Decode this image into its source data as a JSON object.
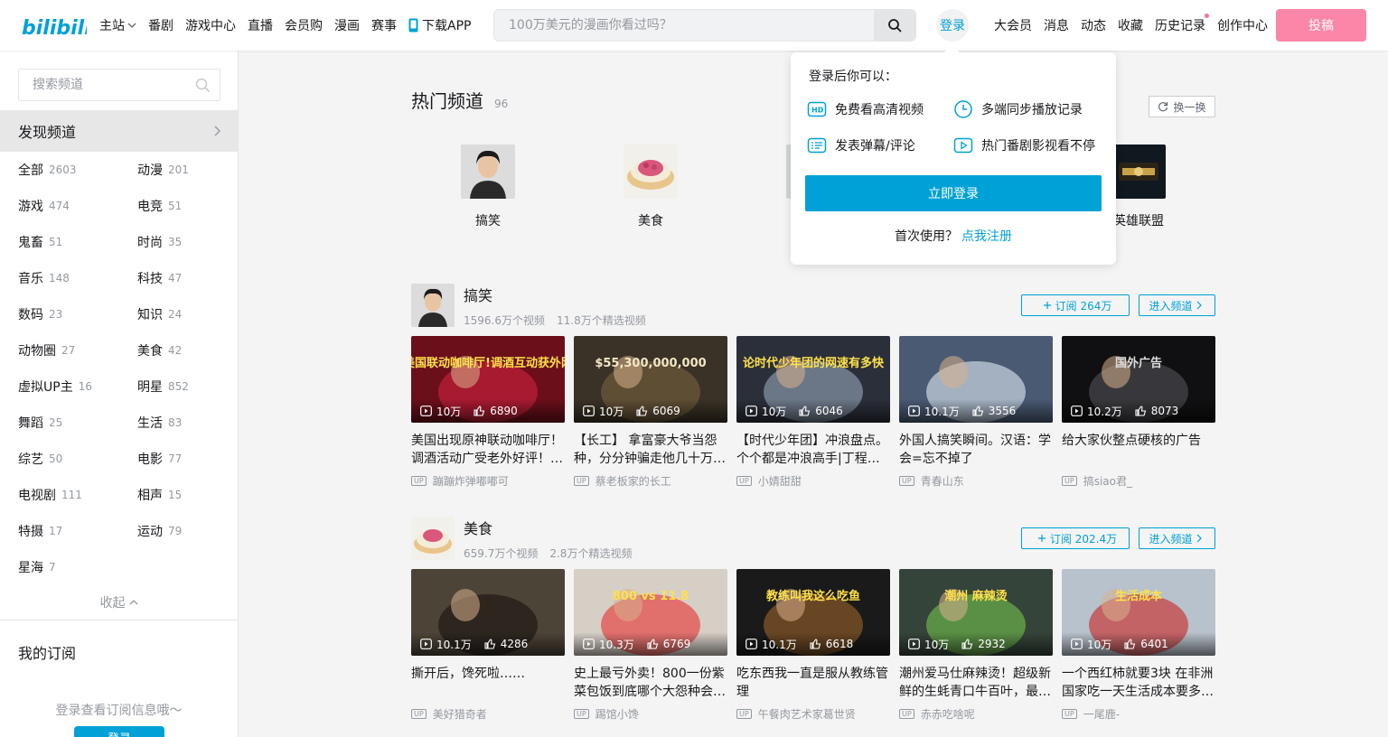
{
  "header": {
    "logo_text": "bilibili",
    "nav_left": [
      "主站",
      "番剧",
      "游戏中心",
      "直播",
      "会员购",
      "漫画",
      "赛事",
      "下载APP"
    ],
    "search_placeholder": "100万美元的漫画你看过吗？",
    "login_label": "登录",
    "nav_right": [
      "大会员",
      "消息",
      "动态",
      "收藏",
      "历史记录",
      "创作中心"
    ],
    "upload_label": "投稿"
  },
  "sidebar": {
    "search_placeholder": "搜索频道",
    "discover_label": "发现频道",
    "categories": [
      {
        "name": "全部",
        "count": "2603"
      },
      {
        "name": "动漫",
        "count": "201"
      },
      {
        "name": "游戏",
        "count": "474"
      },
      {
        "name": "电竞",
        "count": "51"
      },
      {
        "name": "鬼畜",
        "count": "51"
      },
      {
        "name": "时尚",
        "count": "35"
      },
      {
        "name": "音乐",
        "count": "148"
      },
      {
        "name": "科技",
        "count": "47"
      },
      {
        "name": "数码",
        "count": "23"
      },
      {
        "name": "知识",
        "count": "24"
      },
      {
        "name": "动物圈",
        "count": "27"
      },
      {
        "name": "美食",
        "count": "42"
      },
      {
        "name": "虚拟UP主",
        "count": "16"
      },
      {
        "name": "明星",
        "count": "852"
      },
      {
        "name": "舞蹈",
        "count": "25"
      },
      {
        "name": "生活",
        "count": "83"
      },
      {
        "name": "综艺",
        "count": "50"
      },
      {
        "name": "电影",
        "count": "77"
      },
      {
        "name": "电视剧",
        "count": "111"
      },
      {
        "name": "相声",
        "count": "15"
      },
      {
        "name": "特摄",
        "count": "17"
      },
      {
        "name": "运动",
        "count": "79"
      },
      {
        "name": "星海",
        "count": "7"
      }
    ],
    "collapse_label": "收起",
    "my_sub_title": "我的订阅",
    "my_sub_tip": "登录查看订阅信息哦～",
    "login_label": "登录"
  },
  "hot": {
    "title": "热门频道",
    "count": "96",
    "refresh_label": "换一换",
    "channels": [
      {
        "name": "搞笑"
      },
      {
        "name": "美食"
      },
      {
        "name": ""
      },
      {
        "name": ""
      },
      {
        "name": "英雄联盟"
      }
    ]
  },
  "sections": [
    {
      "name": "搞笑",
      "videos_stat": "1596.6万个视频",
      "featured_stat": "11.8万个精选视频",
      "subscribe_label": "订阅 264万",
      "enter_label": "进入频道",
      "cards": [
        {
          "views": "10万",
          "likes": "6890",
          "title": "美国出现原神联动咖啡厅！调酒活动广受老外好评！…",
          "up": "蹦蹦炸弹嘟嘟可",
          "overlay": "原神美国联动咖啡厅!调酒互动获外网疯狂"
        },
        {
          "views": "10万",
          "likes": "6069",
          "title": "【长工】 拿富豪大爷当怨种，分分钟骗走他几十万…",
          "up": "蔡老板家的长工",
          "overlay": "$55,300,000,000"
        },
        {
          "views": "10万",
          "likes": "6046",
          "title": "【时代少年团】冲浪盘点。个个都是冲浪高手|丁程…",
          "up": "小婧甜甜",
          "overlay": "论时代少年团的网速有多快"
        },
        {
          "views": "10.1万",
          "likes": "3556",
          "title": "外国人搞笑瞬间。汉语：学会=忘不掉了",
          "up": "青春山东",
          "overlay": ""
        },
        {
          "views": "10.2万",
          "likes": "8073",
          "title": "给大家伙整点硬核的广告",
          "up": "搞siao君_",
          "overlay": "国外广告"
        }
      ]
    },
    {
      "name": "美食",
      "videos_stat": "659.7万个视频",
      "featured_stat": "2.8万个精选视频",
      "subscribe_label": "订阅 202.4万",
      "enter_label": "进入频道",
      "cards": [
        {
          "views": "10.1万",
          "likes": "4286",
          "title": "撕开后，馋死啦……",
          "up": "美好猎奇者",
          "overlay": ""
        },
        {
          "views": "10.3万",
          "likes": "6769",
          "title": "史上最亏外卖！800一份紫菜包饭到底哪个大怨种会…",
          "up": "踢馆小馋",
          "overlay": "800 vs 11.8"
        },
        {
          "views": "10.1万",
          "likes": "6618",
          "title": "吃东西我一直是服从教练管理",
          "up": "午餐肉艺术家葛世贤",
          "overlay": "教练叫我这么吃鱼"
        },
        {
          "views": "10万",
          "likes": "2932",
          "title": "潮州爱马仕麻辣烫！超级新鲜的生蚝青口牛百叶，最…",
          "up": "赤赤吃啥呢",
          "overlay": "潮州 麻辣烫"
        },
        {
          "views": "10万",
          "likes": "6401",
          "title": "一个西红柿就要3块 在非洲国家吃一天生活成本要多…",
          "up": "一尾鹿-",
          "overlay": "生活成本"
        }
      ]
    }
  ],
  "popover": {
    "title": "登录后你可以：",
    "perks": [
      "免费看高清视频",
      "多端同步播放记录",
      "发表弹幕/评论",
      "热门番剧影视看不停"
    ],
    "login_now": "立即登录",
    "first_use": "首次使用？",
    "register": "点我注册"
  },
  "colors": {
    "accent": "#00a1d6",
    "pink": "#fb7299",
    "muted": "#9499a0"
  }
}
